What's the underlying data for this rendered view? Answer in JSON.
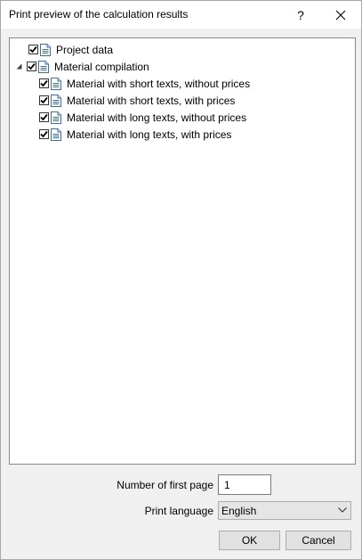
{
  "window": {
    "title": "Print preview of the calculation results",
    "help_glyph": "?",
    "close_glyph": "✕"
  },
  "tree": {
    "items": [
      {
        "label": "Project data",
        "checked": true,
        "level": 0,
        "expandable": false
      },
      {
        "label": "Material compilation",
        "checked": true,
        "level": 0,
        "expandable": true,
        "expanded": true
      },
      {
        "label": "Material with short texts, without prices",
        "checked": true,
        "level": 1,
        "expandable": false
      },
      {
        "label": "Material with short texts, with prices",
        "checked": true,
        "level": 1,
        "expandable": false
      },
      {
        "label": "Material with long texts, without prices",
        "checked": true,
        "level": 1,
        "expandable": false
      },
      {
        "label": "Material with long texts, with prices",
        "checked": true,
        "level": 1,
        "expandable": false
      }
    ],
    "icon": "document-icon"
  },
  "form": {
    "first_page_label": "Number of first page",
    "first_page_value": "1",
    "language_label": "Print language",
    "language_value": "English"
  },
  "buttons": {
    "ok_label": "OK",
    "cancel_label": "Cancel"
  }
}
